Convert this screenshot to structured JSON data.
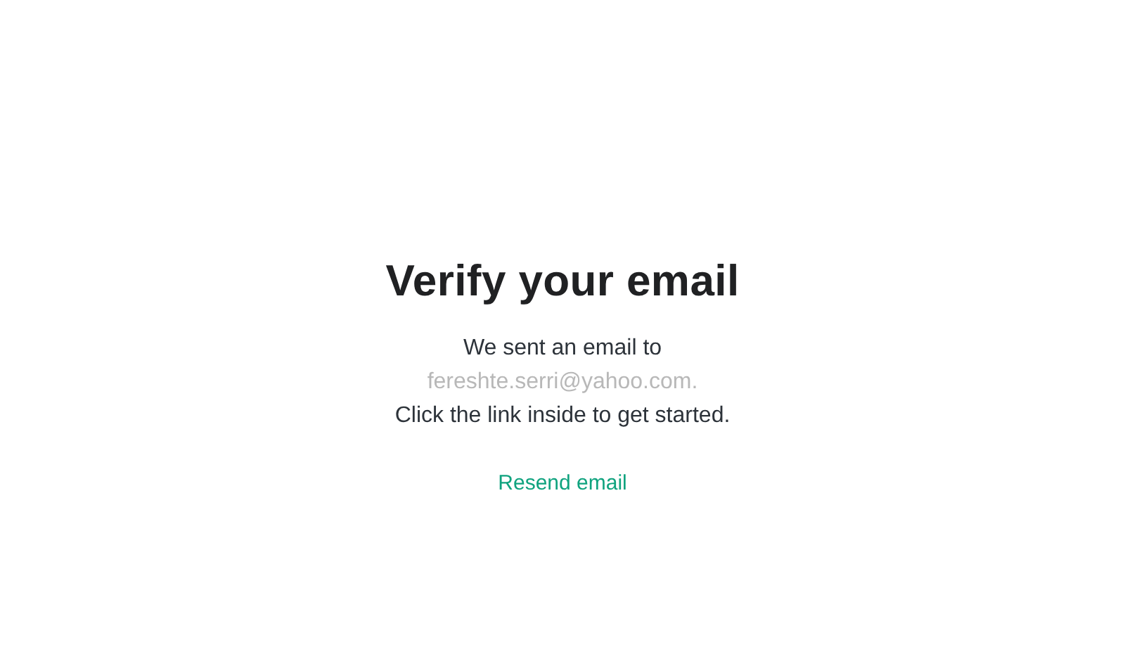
{
  "title": "Verify your email",
  "message": {
    "intro": "We sent an email to",
    "email": "fereshte.serri@yahoo.com.",
    "instruction": "Click the link inside to get started."
  },
  "link": "Resend email"
}
